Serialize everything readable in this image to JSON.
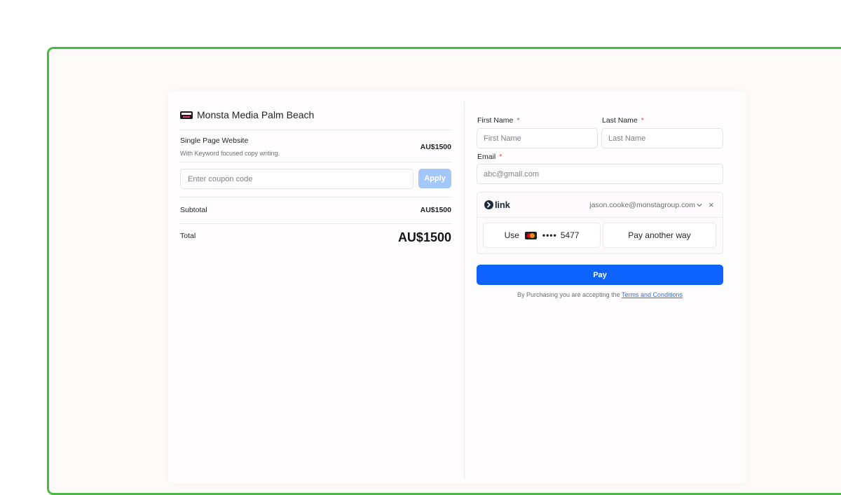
{
  "merchant": {
    "name": "Monsta Media Palm Beach",
    "logo_icon": "monsta-logo-icon"
  },
  "order": {
    "item_title": "Single Page Website",
    "item_description": "With Keyword focused copy writing.",
    "item_price": "AU$1500",
    "coupon_placeholder": "Enter coupon code",
    "apply_label": "Apply",
    "subtotal_label": "Subtotal",
    "subtotal_value": "AU$1500",
    "total_label": "Total",
    "total_value": "AU$1500"
  },
  "form": {
    "first_name_label": "First Name",
    "first_name_placeholder": "First Name",
    "last_name_label": "Last Name",
    "last_name_placeholder": "Last Name",
    "email_label": "Email",
    "email_placeholder": "abc@gmail.com",
    "required_mark": "*"
  },
  "link": {
    "brand": "link",
    "email": "jason.cooke@monstagroup.com",
    "close_glyph": "×",
    "use_label": "Use",
    "card_dots": "••••",
    "card_last4": "5477",
    "pay_another_label": "Pay another way",
    "card_icon": "mastercard-icon"
  },
  "checkout": {
    "pay_label": "Pay",
    "terms_prefix": "By Purchasing you are accepting the",
    "terms_link": "Terms and Conditions"
  },
  "colors": {
    "frame_border": "#4cb944",
    "primary": "#0d63fb",
    "apply_disabled": "#a4c7fb",
    "required": "#e5484d",
    "link_text": "#2f6fe0"
  }
}
